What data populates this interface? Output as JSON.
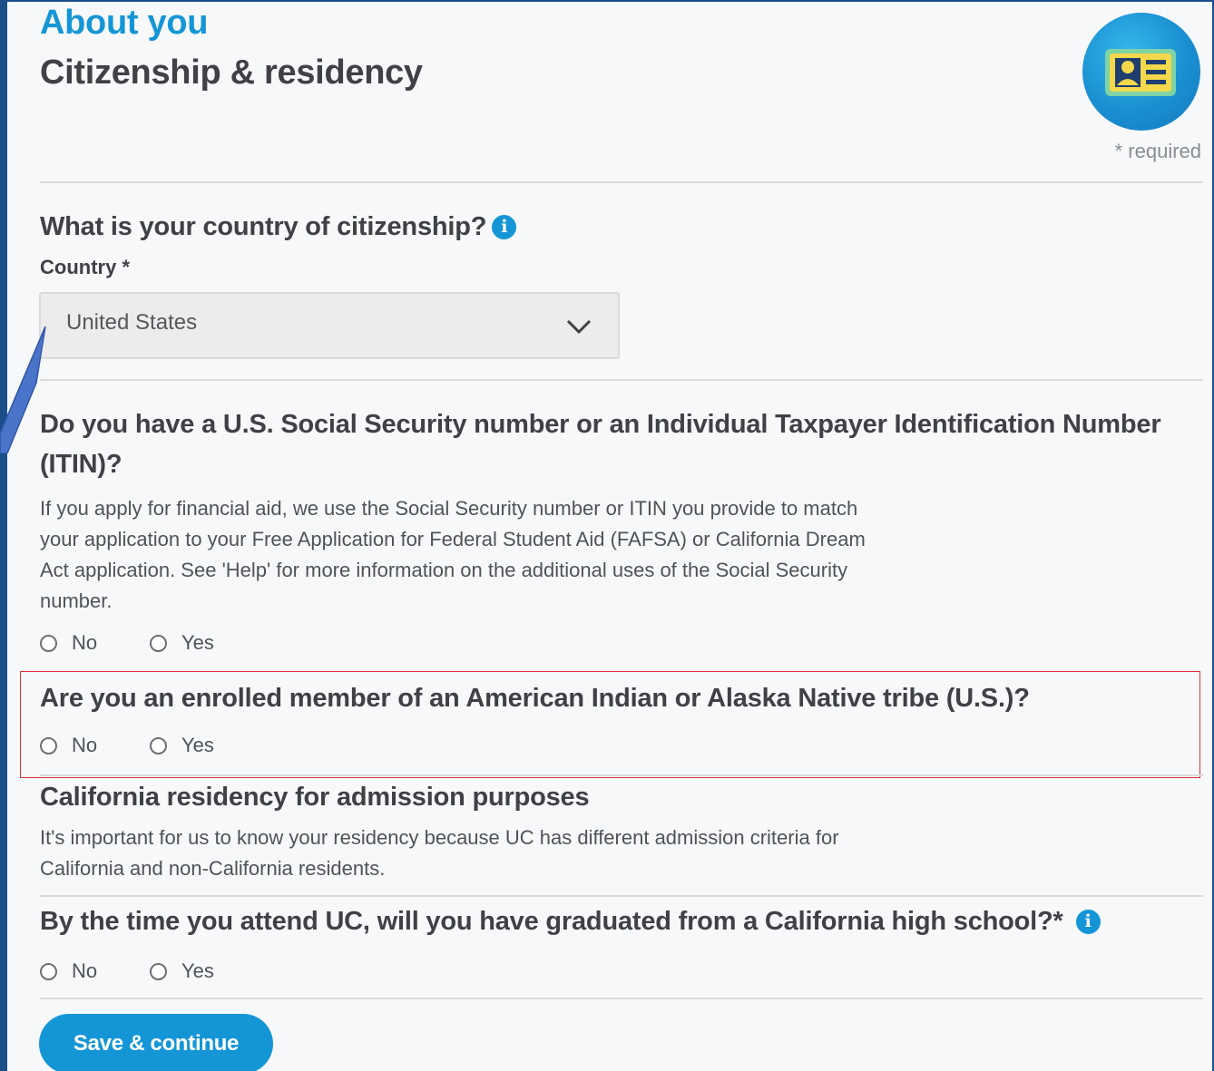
{
  "header": {
    "eyebrow": "About you",
    "title": "Citizenship & residency",
    "required_note": "* required",
    "badge_icon": "id-card-icon"
  },
  "citizenship": {
    "question": "What is your country of citizenship?",
    "field_label": "Country *",
    "selected_country": "United States"
  },
  "ssn": {
    "question_line1": "Do you have a U.S. Social Security number or an Individual Taxpayer Identification Number",
    "question_line2": "(ITIN)?",
    "help_lines": [
      "If you apply for financial aid, we use the Social Security number or ITIN you provide to match",
      "your application to your Free Application for Federal Student Aid (FAFSA) or California Dream",
      "Act application. See 'Help' for more information on the additional uses of the Social Security",
      "number."
    ],
    "options": [
      "No",
      "Yes"
    ]
  },
  "tribe": {
    "question": "Are you an enrolled member of an American Indian or Alaska Native tribe (U.S.)?",
    "options": [
      "No",
      "Yes"
    ]
  },
  "residency": {
    "heading": "California residency for admission purposes",
    "help_lines": [
      "It's important for us to know your residency because UC has different admission criteria for",
      "California and non-California residents."
    ]
  },
  "high_school": {
    "question": "By the time you attend UC, will you have graduated from a California high school?*",
    "options": [
      "No",
      "Yes"
    ]
  },
  "actions": {
    "save_label": "Save & continue"
  },
  "colors": {
    "accent": "#1496d6",
    "highlight": "#e0303a",
    "frame": "#1c4f8a"
  }
}
